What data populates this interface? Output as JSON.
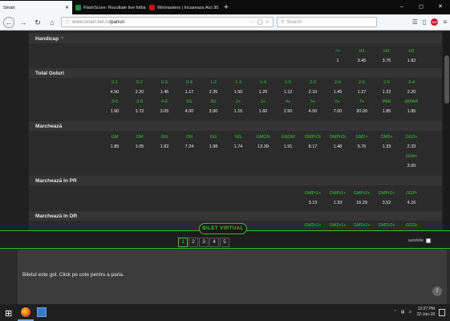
{
  "browser": {
    "tabs": [
      {
        "label": "Smart",
        "active": true,
        "color": "#f5f6f7"
      },
      {
        "label": "FlashScore: Rezultate live fotbal",
        "active": false,
        "color": "#1f8a3a"
      },
      {
        "label": "Winmasters | Incaseaza Aici 30",
        "active": false,
        "color": "#c0141a"
      }
    ],
    "new_tab": "+",
    "window_controls": [
      "–",
      "◻",
      "✕"
    ],
    "url_host": "www.smart-bet.ro",
    "url_path": "/pariuri",
    "url_menu": "···",
    "search_placeholder": "Search"
  },
  "sections": [
    {
      "title": "Handicap",
      "rows": [
        {
          "cells": [
            {
              "t": "-/+",
              "k": "lbl"
            },
            {
              "t": "H1",
              "k": "lbl"
            },
            {
              "t": "HX",
              "k": "lbl"
            },
            {
              "t": "H2",
              "k": "lbl"
            }
          ]
        },
        {
          "cells": [
            {
              "t": "1",
              "k": "val"
            },
            {
              "t": "3.45",
              "k": "val"
            },
            {
              "t": "3.75",
              "k": "val"
            },
            {
              "t": "1.82",
              "k": "val"
            }
          ]
        }
      ]
    },
    {
      "title": "Total Goluri",
      "rows": [
        {
          "cells": [
            {
              "t": "0-1",
              "k": "lbl"
            },
            {
              "t": "0-2",
              "k": "lbl"
            },
            {
              "t": "0-3",
              "k": "lbl"
            },
            {
              "t": "0-4",
              "k": "lbl"
            },
            {
              "t": "1-2",
              "k": "lbl"
            },
            {
              "t": "1-3",
              "k": "lbl"
            },
            {
              "t": "1-4",
              "k": "lbl"
            },
            {
              "t": "1-5",
              "k": "lbl"
            },
            {
              "t": "2-3",
              "k": "lbl"
            },
            {
              "t": "2-4",
              "k": "lbl"
            },
            {
              "t": "2-5",
              "k": "lbl"
            },
            {
              "t": "2-6",
              "k": "lbl"
            },
            {
              "t": "3-4",
              "k": "lbl"
            }
          ]
        },
        {
          "cells": [
            {
              "t": "4.50",
              "k": "val"
            },
            {
              "t": "2.20",
              "k": "val"
            },
            {
              "t": "1.45",
              "k": "val"
            },
            {
              "t": "1.17",
              "k": "val"
            },
            {
              "t": "2.35",
              "k": "val"
            },
            {
              "t": "1.50",
              "k": "val"
            },
            {
              "t": "1.26",
              "k": "val"
            },
            {
              "t": "1.12",
              "k": "val"
            },
            {
              "t": "2.10",
              "k": "val"
            },
            {
              "t": "1.45",
              "k": "val"
            },
            {
              "t": "1.27",
              "k": "val"
            },
            {
              "t": "1.22",
              "k": "val"
            },
            {
              "t": "2.20",
              "k": "val"
            }
          ]
        },
        {
          "cells": [
            {
              "t": "3-5",
              "k": "lbl"
            },
            {
              "t": "3-6",
              "k": "lbl"
            },
            {
              "t": "4-6",
              "k": "lbl"
            },
            {
              "t": "2G",
              "k": "lbl"
            },
            {
              "t": "3G",
              "k": "lbl"
            },
            {
              "t": "2+",
              "k": "lbl"
            },
            {
              "t": "3+",
              "k": "lbl"
            },
            {
              "t": "4+",
              "k": "lbl"
            },
            {
              "t": "5+",
              "k": "lbl"
            },
            {
              "t": "6+",
              "k": "lbl"
            },
            {
              "t": "7+",
              "k": "lbl"
            },
            {
              "t": "PAR",
              "k": "lbl"
            },
            {
              "t": "IMPAR",
              "k": "lbl"
            }
          ]
        },
        {
          "cells": [
            {
              "t": "1.90",
              "k": "val"
            },
            {
              "t": "1.72",
              "k": "val"
            },
            {
              "t": "3.05",
              "k": "val"
            },
            {
              "t": "4.00",
              "k": "val"
            },
            {
              "t": "3.90",
              "k": "val"
            },
            {
              "t": "1.15",
              "k": "val"
            },
            {
              "t": "1.60",
              "k": "val"
            },
            {
              "t": "2.50",
              "k": "val"
            },
            {
              "t": "4.50",
              "k": "val"
            },
            {
              "t": "7.00",
              "k": "val"
            },
            {
              "t": "20.00",
              "k": "val"
            },
            {
              "t": "1.85",
              "k": "val"
            },
            {
              "t": "1.85",
              "k": "val"
            }
          ]
        }
      ]
    },
    {
      "title": "Marchează",
      "rows": [
        {
          "cells": [
            {
              "t": "GM",
              "k": "lbl"
            },
            {
              "t": "OM",
              "k": "lbl"
            },
            {
              "t": "GN",
              "k": "lbl"
            },
            {
              "t": "ON",
              "k": "lbl"
            },
            {
              "t": "GG",
              "k": "lbl"
            },
            {
              "t": "NG",
              "k": "lbl"
            },
            {
              "t": "GMON",
              "k": "lbl"
            },
            {
              "t": "GNOM",
              "k": "lbl"
            },
            {
              "t": "GMPrOr",
              "k": "lbl"
            },
            {
              "t": "OMPrOr",
              "k": "lbl"
            },
            {
              "t": "GM2+",
              "k": "lbl"
            },
            {
              "t": "OM2+",
              "k": "lbl"
            },
            {
              "t": "GG3+",
              "k": "lbl"
            }
          ]
        },
        {
          "cells": [
            {
              "t": "1.85",
              "k": "val"
            },
            {
              "t": "1.05",
              "k": "val"
            },
            {
              "t": "1.82",
              "k": "val"
            },
            {
              "t": "7.24",
              "k": "val"
            },
            {
              "t": "1.98",
              "k": "val"
            },
            {
              "t": "1.74",
              "k": "val"
            },
            {
              "t": "13.39",
              "k": "val"
            },
            {
              "t": "1.91",
              "k": "val"
            },
            {
              "t": "8.17",
              "k": "val"
            },
            {
              "t": "1.48",
              "k": "val"
            },
            {
              "t": "5.76",
              "k": "val"
            },
            {
              "t": "1.33",
              "k": "val"
            },
            {
              "t": "2.33",
              "k": "val"
            }
          ]
        },
        {
          "cells": [
            {
              "t": "GG4+",
              "k": "lbl"
            }
          ]
        },
        {
          "cells": [
            {
              "t": "3.00",
              "k": "val"
            }
          ]
        }
      ]
    },
    {
      "title": "Marchează în PR",
      "rows": [
        {
          "cells": [
            {
              "t": "GMPr1+",
              "k": "lbl"
            },
            {
              "t": "OMPr1+",
              "k": "lbl"
            },
            {
              "t": "GMPr2+",
              "k": "lbl"
            },
            {
              "t": "OMPr2+",
              "k": "lbl"
            },
            {
              "t": "GGPr",
              "k": "lbl"
            }
          ]
        },
        {
          "cells": [
            {
              "t": "3.13",
              "k": "val"
            },
            {
              "t": "1.33",
              "k": "val"
            },
            {
              "t": "16.29",
              "k": "val"
            },
            {
              "t": "3.52",
              "k": "val"
            },
            {
              "t": "4.16",
              "k": "val"
            }
          ]
        }
      ]
    },
    {
      "title": "Marchează în DR",
      "rows": [
        {
          "cells": [
            {
              "t": "GMDr1+",
              "k": "lbl"
            },
            {
              "t": "OMDr1+",
              "k": "lbl"
            },
            {
              "t": "GMDr2+",
              "k": "lbl"
            },
            {
              "t": "OMDr2+",
              "k": "lbl"
            },
            {
              "t": "GGDr",
              "k": "lbl"
            }
          ]
        }
      ]
    }
  ],
  "bilet_button": "BILET VIRTUAL",
  "pages": [
    "1",
    "2",
    "3",
    "4",
    "5"
  ],
  "active_page": "1",
  "autohide_label": "autohide",
  "bilet_message": "Biletul este gol. Click pe cote pentru a paria.",
  "taskbar": {
    "time": "12:27 PM",
    "date": "22-Jan-18"
  },
  "colors": {
    "accent": "#3ac43a",
    "label_green": "#3bc33b",
    "background": "#2b2b2b"
  }
}
